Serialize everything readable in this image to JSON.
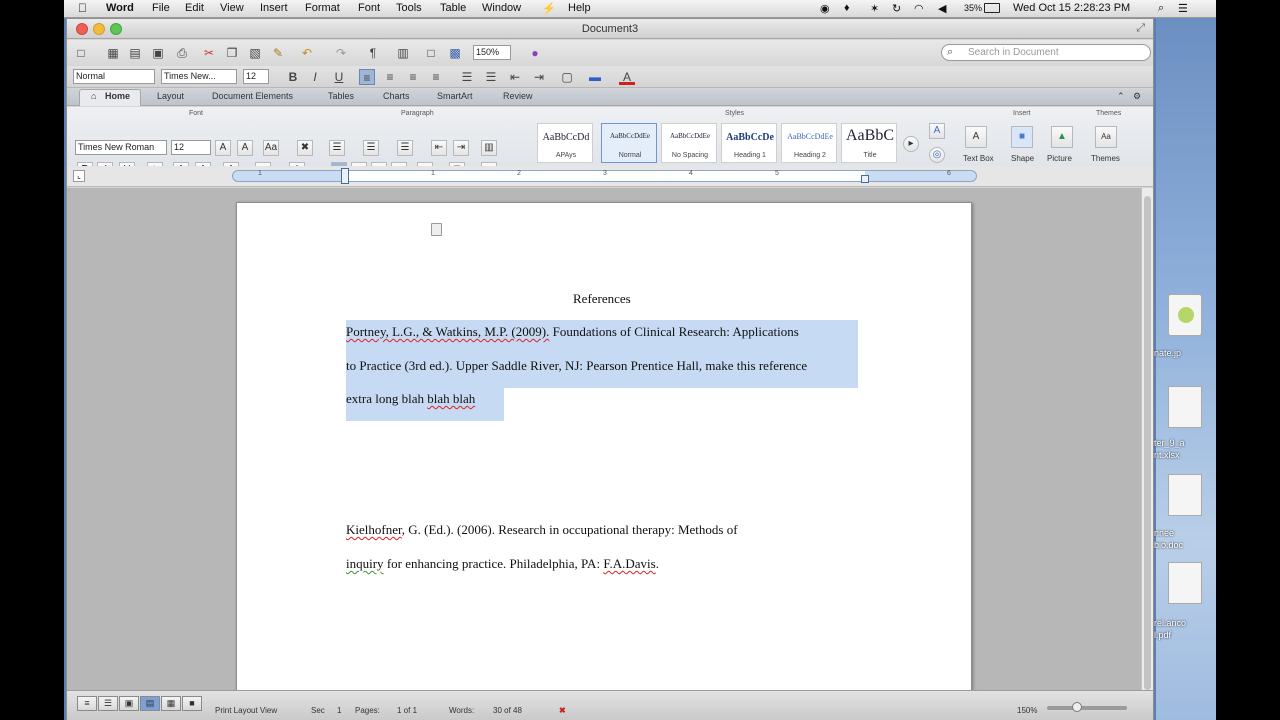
{
  "menubar": {
    "apple": "",
    "app": "Word",
    "items": [
      "File",
      "Edit",
      "View",
      "Insert",
      "Format",
      "Font",
      "Tools",
      "Table",
      "Window",
      "Help"
    ],
    "battery": "35%",
    "clock": "Wed Oct 15  2:28:23 PM"
  },
  "window": {
    "title": "Document3"
  },
  "toolbar": {
    "zoom": "150%",
    "search_placeholder": "Search in Document",
    "style_field": "Normal",
    "font_field": "Times New...",
    "size_field": "12"
  },
  "ribbon_tabs": [
    "Home",
    "Layout",
    "Document Elements",
    "Tables",
    "Charts",
    "SmartArt",
    "Review"
  ],
  "ribbon": {
    "groups": {
      "font": "Font",
      "paragraph": "Paragraph",
      "styles": "Styles",
      "insert": "Insert",
      "themes": "Themes"
    },
    "font_name": "Times New Roman",
    "font_size": "12",
    "styles": [
      {
        "sample": "AaBbCcDd",
        "name": "APAys"
      },
      {
        "sample": "AaBbCcDdEe",
        "name": "Normal"
      },
      {
        "sample": "AaBbCcDdEe",
        "name": "No Spacing"
      },
      {
        "sample": "AaBbCcDe",
        "name": "Heading 1"
      },
      {
        "sample": "AaBbCcDdEe",
        "name": "Heading 2"
      },
      {
        "sample": "AaBbC",
        "name": "Title"
      }
    ],
    "insert_items": [
      "Text Box",
      "Shape",
      "Picture"
    ],
    "themes_label": "Themes"
  },
  "ruler_numbers": [
    "1",
    "1",
    "2",
    "3",
    "4",
    "5",
    "6"
  ],
  "document": {
    "heading": "References",
    "ref1_line1_a": "Portney, L.G., & Watkins, M.P. (2009).",
    "ref1_line1_b": " Foundations of Clinical Research: Applications",
    "ref1_line2": "to Practice (3rd ed.). Upper Saddle River, NJ: Pearson Prentice Hall, make this reference",
    "ref1_line3_a": "extra long blah ",
    "ref1_line3_b": "blah blah",
    "ref2_line1_a": "Kielhofner",
    "ref2_line1_b": ", G. (Ed.). (2006). Research in occupational therapy: Methods of",
    "ref2_line2_a": "inquiry",
    "ref2_line2_b": " for enhancing practice. Philadelphia, PA: ",
    "ref2_line2_c": "F.A.Davis",
    "ref2_line2_d": "."
  },
  "status": {
    "view": "Print Layout View",
    "sec_label": "Sec",
    "sec": "1",
    "pages_label": "Pages:",
    "pages": "1 of 1",
    "words_label": "Words:",
    "words": "30 of 48",
    "zoom": "150%"
  },
  "desktop": {
    "labels": [
      "nate.jp",
      "ter_9_a",
      "nt.xlsx",
      "nnee",
      "bio.doc",
      "rel.anco",
      "l.pdf"
    ]
  }
}
